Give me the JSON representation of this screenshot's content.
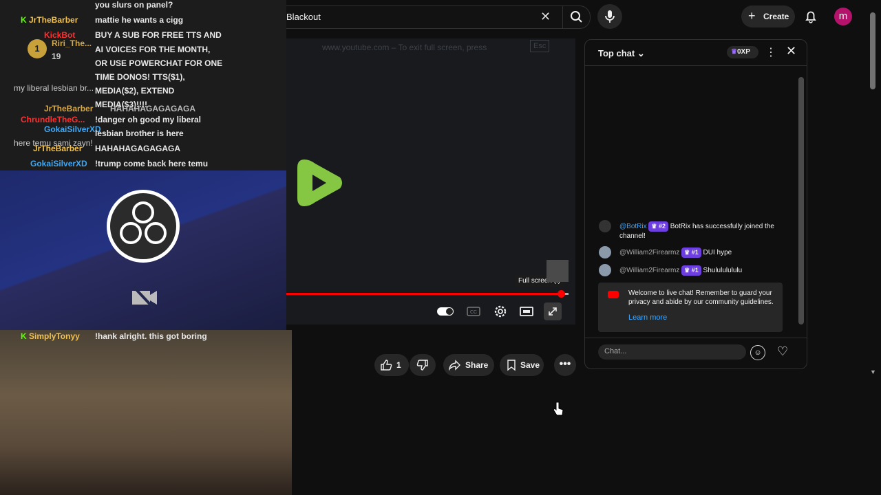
{
  "header": {
    "search_value": "The Blackout",
    "create_label": "Create",
    "avatar_letter": "m"
  },
  "player": {
    "fullscreen_hint": "www.youtube.com – To exit full screen, press",
    "esc_key": "Esc",
    "tooltip": "Full screen (f)",
    "progress_fraction": 0.97,
    "overlay_chat": [
      {
        "author": "",
        "text": "you slurs on panel?"
      },
      {
        "author": "JrTheBarber",
        "text": "mattie he wants a cigg"
      },
      {
        "author": "KickBot",
        "text": "BUY A SUB FOR FREE TTS AND"
      },
      {
        "author": "Riri_The...",
        "text": "AI VOICES FOR THE MONTH,"
      },
      {
        "author": "",
        "text": "OR USE POWERCHAT FOR ONE"
      },
      {
        "author": "",
        "text": "TIME DONOS! TTS($1),"
      },
      {
        "author": "my liberal lesbian br...",
        "text": "MEDIA($2), EXTEND"
      },
      {
        "author": "",
        "text": "MEDIA($3)!!!!"
      },
      {
        "author": "JrTheBarber",
        "text": "HAHAHAGAGAGAGA"
      },
      {
        "author": "ChrundleTheG...",
        "text": "!danger oh good my liberal"
      },
      {
        "author": "GokaiSilverXD",
        "text": "lesbian brother is here"
      },
      {
        "author": "here temu sami zayn!",
        "text": ""
      },
      {
        "author": "JrTheBarber",
        "text": "HAHAHAGAGAGAGA"
      },
      {
        "author": "GokaiSilverXD",
        "text": "!trump come back here temu"
      }
    ],
    "overlay_chat_bottom": {
      "author": "SimplyTonyy",
      "text": "!hank alright. this got boring"
    },
    "overlay_badge_count": "19",
    "overlay_rank": "1"
  },
  "actions": {
    "like_count": "1",
    "share_label": "Share",
    "save_label": "Save"
  },
  "chat": {
    "title": "Top chat",
    "xp": "0XP",
    "messages": [
      {
        "author": "@BotRix",
        "rank": "#2",
        "text": "BotRix has successfully joined the channel!"
      },
      {
        "author": "@William2Firearmz",
        "rank": "#1",
        "text": "DUI hype"
      },
      {
        "author": "@William2Firearmz",
        "rank": "#1",
        "text": "Shulululululu"
      }
    ],
    "welcome_text": "Welcome to live chat! Remember to guard your privacy and abide by our community guidelines.",
    "learn_more": "Learn more",
    "input_placeholder": "Chat..."
  },
  "colors": {
    "accent": "#ff0000",
    "rumble_green": "#85c742",
    "chat_rank": "#6d3ee0",
    "avatar": "#b5126b"
  }
}
